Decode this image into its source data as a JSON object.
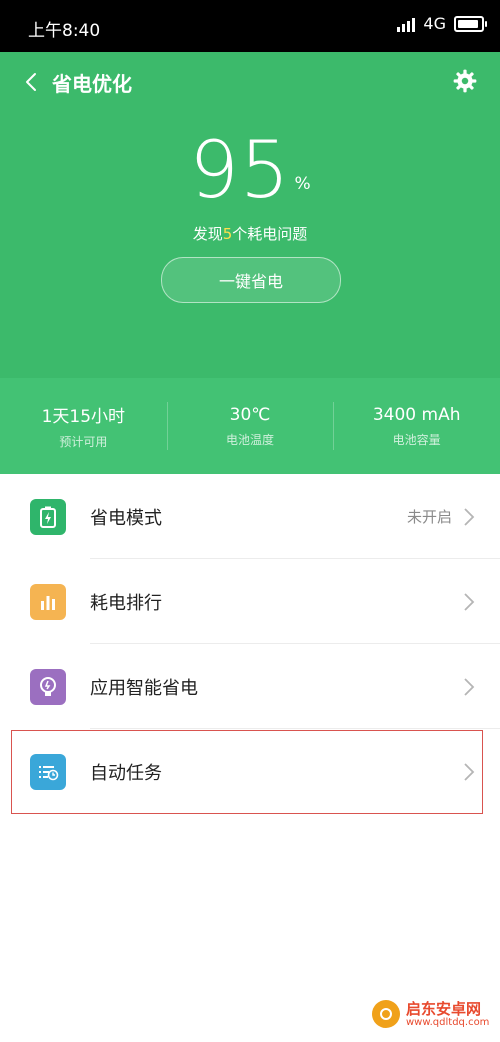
{
  "status_bar": {
    "time": "上午8:40",
    "network": "4G"
  },
  "header": {
    "title": "省电优化"
  },
  "battery": {
    "percent": "95",
    "unit": "%",
    "issues_prefix": "发现",
    "issues_count": "5",
    "issues_suffix": "个耗电问题",
    "one_key_label": "一键省电"
  },
  "stats": [
    {
      "value": "1天15小时",
      "label": "预计可用"
    },
    {
      "value": "30℃",
      "label": "电池温度"
    },
    {
      "value": "3400 mAh",
      "label": "电池容量"
    }
  ],
  "menu": [
    {
      "label": "省电模式",
      "value": "未开启",
      "icon": "battery-saver-icon",
      "color": "#2fb56b"
    },
    {
      "label": "耗电排行",
      "value": "",
      "icon": "bar-chart-icon",
      "color": "#f5b452"
    },
    {
      "label": "应用智能省电",
      "value": "",
      "icon": "lightbulb-icon",
      "color": "#9b6fc0"
    },
    {
      "label": "自动任务",
      "value": "",
      "icon": "scheduled-list-icon",
      "color": "#3aa7d9"
    }
  ],
  "watermark": {
    "name": "启东安卓网",
    "url": "www.qdltdq.com"
  }
}
